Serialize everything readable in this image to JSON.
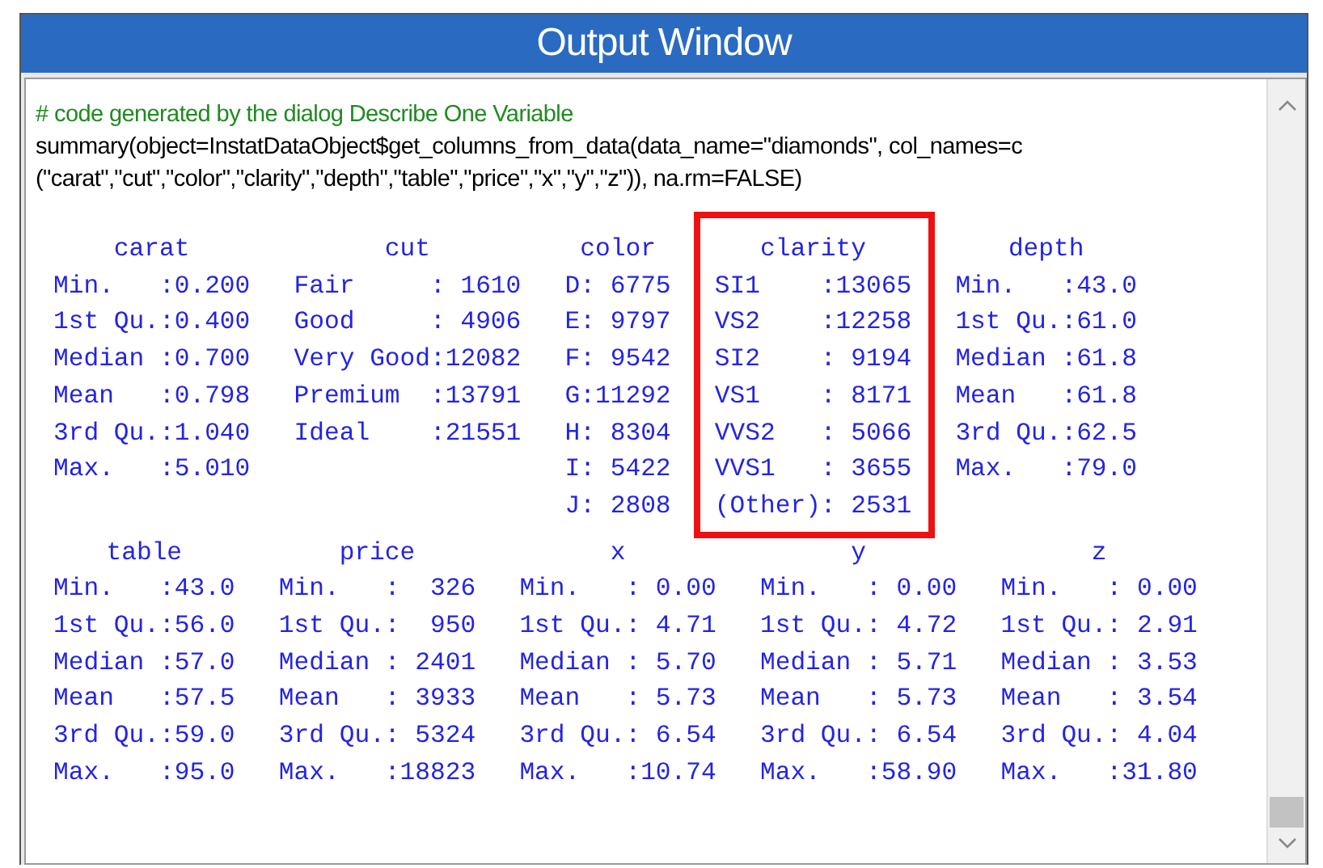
{
  "window": {
    "title": "Output Window"
  },
  "code": {
    "comment": "# code generated by the dialog Describe One Variable",
    "lines": [
      "summary(object=InstatDataObject$get_columns_from_data(data_name=\"diamonds\", col_names=c",
      "(\"carat\",\"cut\",\"color\",\"clarity\",\"depth\",\"table\",\"price\",\"x\",\"y\",\"z\")), na.rm=FALSE)"
    ]
  },
  "summary_blocks": [
    {
      "columns": [
        {
          "header": "carat",
          "highlighted": false,
          "rows": [
            "Min.   :0.200",
            "1st Qu.:0.400",
            "Median :0.700",
            "Mean   :0.798",
            "3rd Qu.:1.040",
            "Max.   :5.010"
          ]
        },
        {
          "header": "cut",
          "highlighted": false,
          "rows": [
            "Fair     : 1610",
            "Good     : 4906",
            "Very Good:12082",
            "Premium  :13791",
            "Ideal    :21551"
          ]
        },
        {
          "header": "color",
          "highlighted": false,
          "rows": [
            "D: 6775",
            "E: 9797",
            "F: 9542",
            "G:11292",
            "H: 8304",
            "I: 5422",
            "J: 2808"
          ]
        },
        {
          "header": "clarity",
          "highlighted": true,
          "rows": [
            "SI1    :13065",
            "VS2    :12258",
            "SI2    : 9194",
            "VS1    : 8171",
            "VVS2   : 5066",
            "VVS1   : 3655",
            "(Other): 2531"
          ]
        },
        {
          "header": "depth",
          "highlighted": false,
          "rows": [
            "Min.   :43.0",
            "1st Qu.:61.0",
            "Median :61.8",
            "Mean   :61.8",
            "3rd Qu.:62.5",
            "Max.   :79.0"
          ]
        }
      ]
    },
    {
      "columns": [
        {
          "header": "table",
          "highlighted": false,
          "rows": [
            "Min.   :43.0",
            "1st Qu.:56.0",
            "Median :57.0",
            "Mean   :57.5",
            "3rd Qu.:59.0",
            "Max.   :95.0"
          ]
        },
        {
          "header": "price",
          "highlighted": false,
          "rows": [
            "Min.   :  326",
            "1st Qu.:  950",
            "Median : 2401",
            "Mean   : 3933",
            "3rd Qu.: 5324",
            "Max.   :18823"
          ]
        },
        {
          "header": "x",
          "highlighted": false,
          "rows": [
            "Min.   : 0.00",
            "1st Qu.: 4.71",
            "Median : 5.70",
            "Mean   : 5.73",
            "3rd Qu.: 6.54",
            "Max.   :10.74"
          ]
        },
        {
          "header": "y",
          "highlighted": false,
          "rows": [
            "Min.   : 0.00",
            "1st Qu.: 4.72",
            "Median : 5.71",
            "Mean   : 5.73",
            "3rd Qu.: 6.54",
            "Max.   :58.90"
          ]
        },
        {
          "header": "z",
          "highlighted": false,
          "rows": [
            "Min.   : 0.00",
            "1st Qu.: 2.91",
            "Median : 3.53",
            "Mean   : 3.54",
            "3rd Qu.: 4.04",
            "Max.   :31.80"
          ]
        }
      ]
    }
  ]
}
